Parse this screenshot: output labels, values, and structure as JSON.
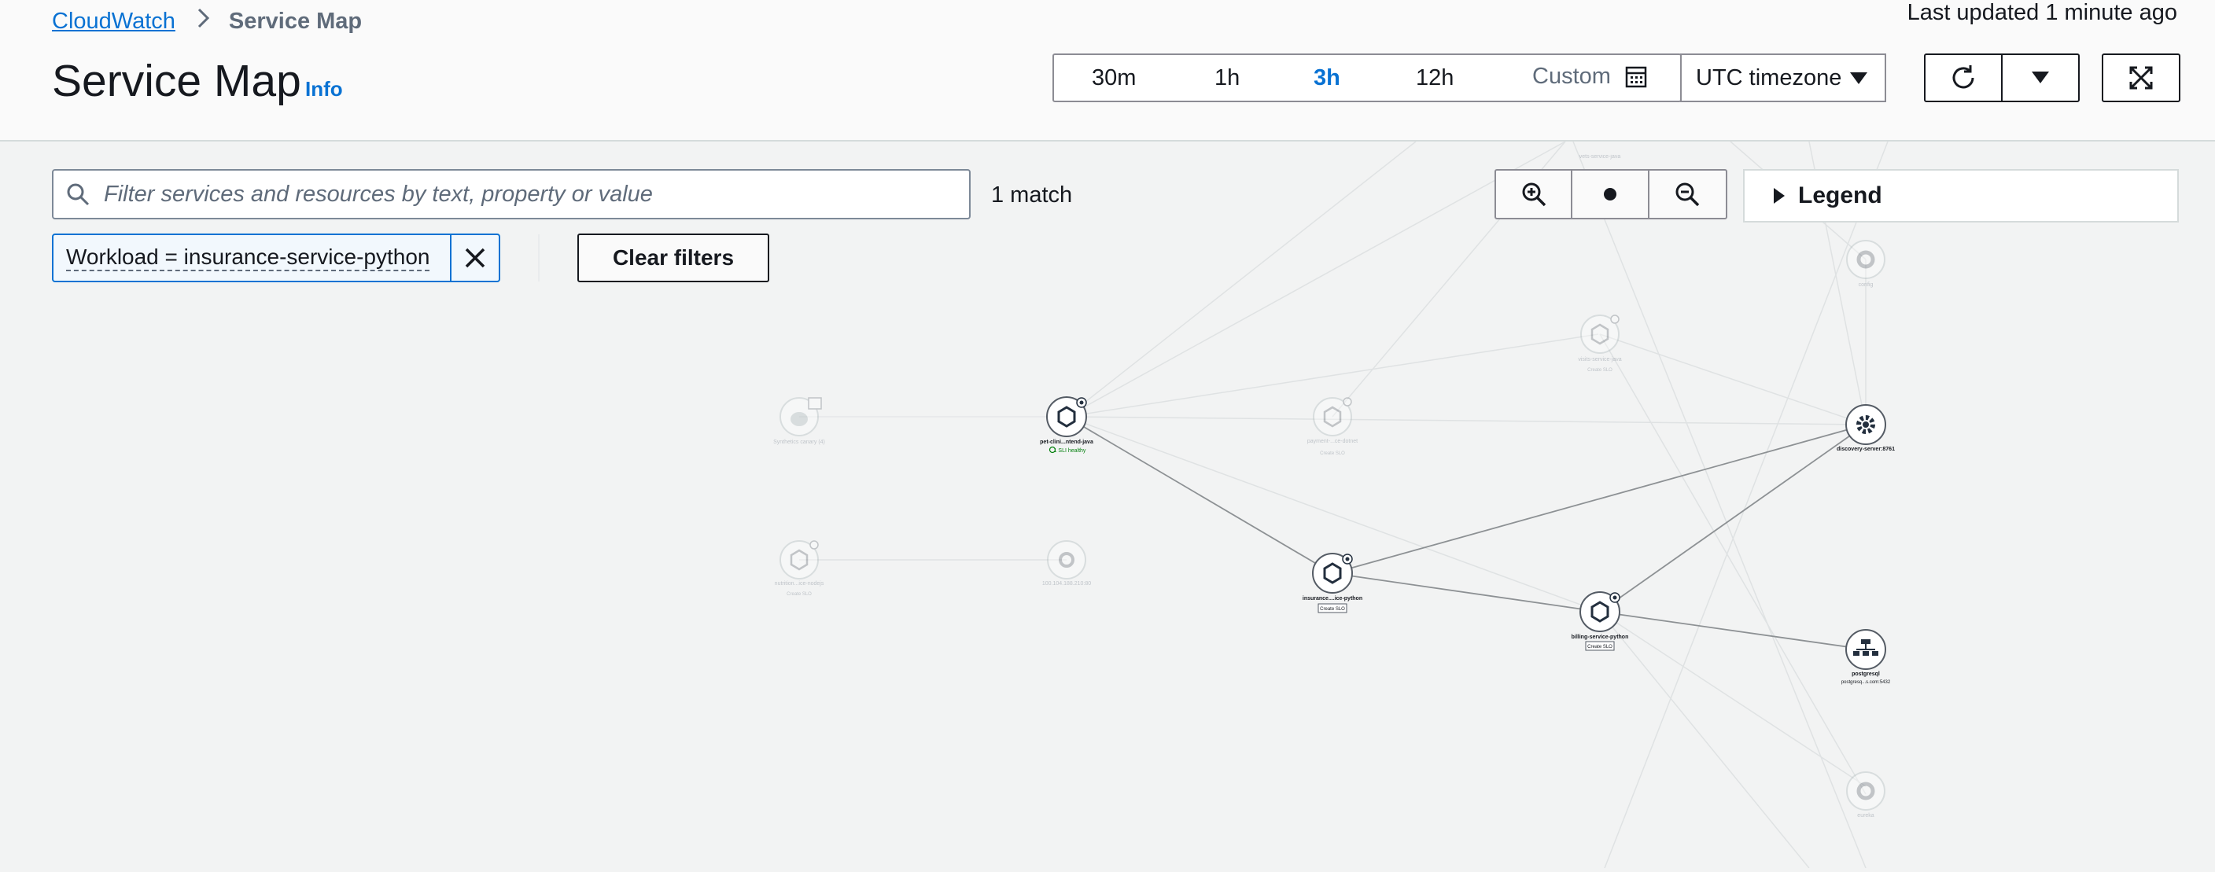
{
  "breadcrumb": {
    "root": "CloudWatch",
    "current": "Service Map"
  },
  "header": {
    "title": "Service Map",
    "info": "Info",
    "last_updated": "Last updated 1 minute ago"
  },
  "time_range": {
    "options": [
      "30m",
      "1h",
      "3h",
      "12h"
    ],
    "selected": "3h",
    "custom": "Custom",
    "timezone": "UTC timezone"
  },
  "filter": {
    "placeholder": "Filter services and resources by text, property or value",
    "value": "",
    "match_count": "1 match",
    "token": "Workload = insurance-service-python",
    "clear_label": "Clear filters"
  },
  "legend": {
    "label": "Legend"
  },
  "map": {
    "nodes": {
      "synthetics": {
        "label": "Synthetics canary (4)"
      },
      "pet_clinic": {
        "label": "pet-clini...ntend-java",
        "status": "1 SLI healthy"
      },
      "payment": {
        "label": "payment-...ce-dotnet",
        "sub": "Create SLO"
      },
      "discovery": {
        "label": "discovery-server:8761"
      },
      "insurance": {
        "label": "insurance....ice-python",
        "sub": "Create SLO"
      },
      "billing": {
        "label": "billing-service-python",
        "sub": "Create SLO"
      },
      "postgres": {
        "label": "postgresql",
        "sub": "postgresq...s.com:5432"
      },
      "nutrition": {
        "label": "nutrition...ice-nodejs",
        "sub": "Create SLO"
      },
      "ip_node": {
        "label": "100.104.188.210:80"
      },
      "visits": {
        "label": "visits-service-java",
        "sub": "Create SLO"
      },
      "top_service": {
        "label": "vets-service-java"
      },
      "config": {
        "label": "config"
      },
      "eureka": {
        "label": "eureka"
      }
    }
  },
  "colors": {
    "link": "#0972d3",
    "healthy": "#037f0c",
    "edge": "#b8bcbf"
  }
}
